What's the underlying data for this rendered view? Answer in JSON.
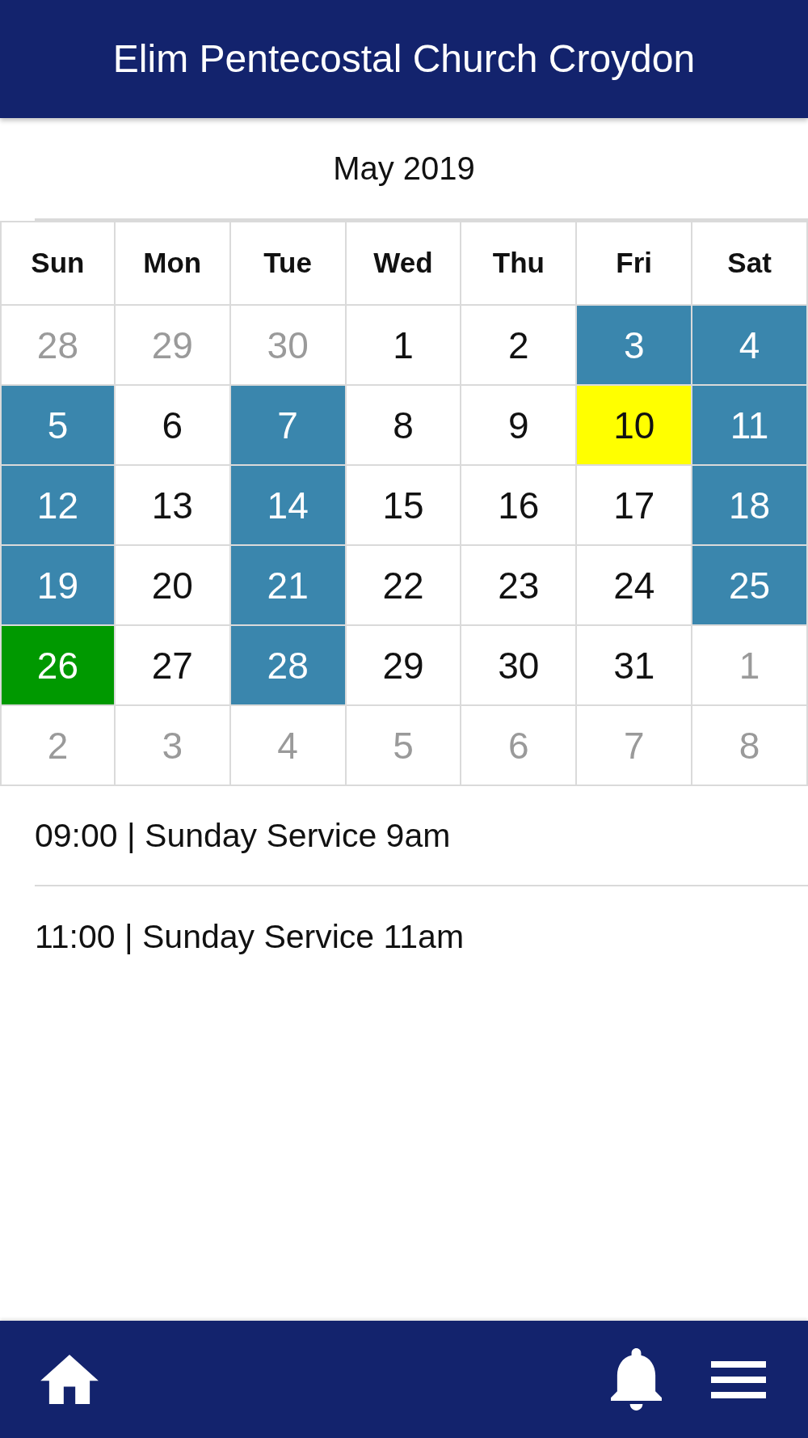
{
  "header": {
    "title": "Elim Pentecostal Church Croydon"
  },
  "calendar": {
    "month": "May 2019",
    "weekdays": [
      "Sun",
      "Mon",
      "Tue",
      "Wed",
      "Thu",
      "Fri",
      "Sat"
    ],
    "weeks": [
      [
        {
          "day": "28",
          "kind": "outside",
          "selected": false
        },
        {
          "day": "29",
          "kind": "outside",
          "selected": false
        },
        {
          "day": "30",
          "kind": "outside",
          "selected": false
        },
        {
          "day": "1",
          "kind": "plain",
          "selected": false
        },
        {
          "day": "2",
          "kind": "plain",
          "selected": false
        },
        {
          "day": "3",
          "kind": "event",
          "selected": false
        },
        {
          "day": "4",
          "kind": "event",
          "selected": false
        }
      ],
      [
        {
          "day": "5",
          "kind": "event",
          "selected": false
        },
        {
          "day": "6",
          "kind": "plain",
          "selected": false
        },
        {
          "day": "7",
          "kind": "event",
          "selected": false
        },
        {
          "day": "8",
          "kind": "plain",
          "selected": false
        },
        {
          "day": "9",
          "kind": "plain",
          "selected": false
        },
        {
          "day": "10",
          "kind": "today",
          "selected": false
        },
        {
          "day": "11",
          "kind": "event",
          "selected": false
        }
      ],
      [
        {
          "day": "12",
          "kind": "event",
          "selected": false
        },
        {
          "day": "13",
          "kind": "plain",
          "selected": false
        },
        {
          "day": "14",
          "kind": "event",
          "selected": false
        },
        {
          "day": "15",
          "kind": "plain",
          "selected": false
        },
        {
          "day": "16",
          "kind": "plain",
          "selected": false
        },
        {
          "day": "17",
          "kind": "plain",
          "selected": false
        },
        {
          "day": "18",
          "kind": "event",
          "selected": false
        }
      ],
      [
        {
          "day": "19",
          "kind": "event",
          "selected": false
        },
        {
          "day": "20",
          "kind": "plain",
          "selected": false
        },
        {
          "day": "21",
          "kind": "event",
          "selected": false
        },
        {
          "day": "22",
          "kind": "plain",
          "selected": false
        },
        {
          "day": "23",
          "kind": "plain",
          "selected": false
        },
        {
          "day": "24",
          "kind": "plain",
          "selected": false
        },
        {
          "day": "25",
          "kind": "event",
          "selected": false
        }
      ],
      [
        {
          "day": "26",
          "kind": "event",
          "selected": true
        },
        {
          "day": "27",
          "kind": "plain",
          "selected": false
        },
        {
          "day": "28",
          "kind": "event",
          "selected": false
        },
        {
          "day": "29",
          "kind": "plain",
          "selected": false
        },
        {
          "day": "30",
          "kind": "plain",
          "selected": false
        },
        {
          "day": "31",
          "kind": "plain",
          "selected": false
        },
        {
          "day": "1",
          "kind": "outside",
          "selected": false
        }
      ],
      [
        {
          "day": "2",
          "kind": "outside",
          "selected": false
        },
        {
          "day": "3",
          "kind": "outside",
          "selected": false
        },
        {
          "day": "4",
          "kind": "outside",
          "selected": false
        },
        {
          "day": "5",
          "kind": "outside",
          "selected": false
        },
        {
          "day": "6",
          "kind": "outside",
          "selected": false
        },
        {
          "day": "7",
          "kind": "outside",
          "selected": false
        },
        {
          "day": "8",
          "kind": "outside",
          "selected": false
        }
      ]
    ]
  },
  "events": [
    "09:00 | Sunday Service 9am",
    "11:00 | Sunday Service 11am"
  ]
}
